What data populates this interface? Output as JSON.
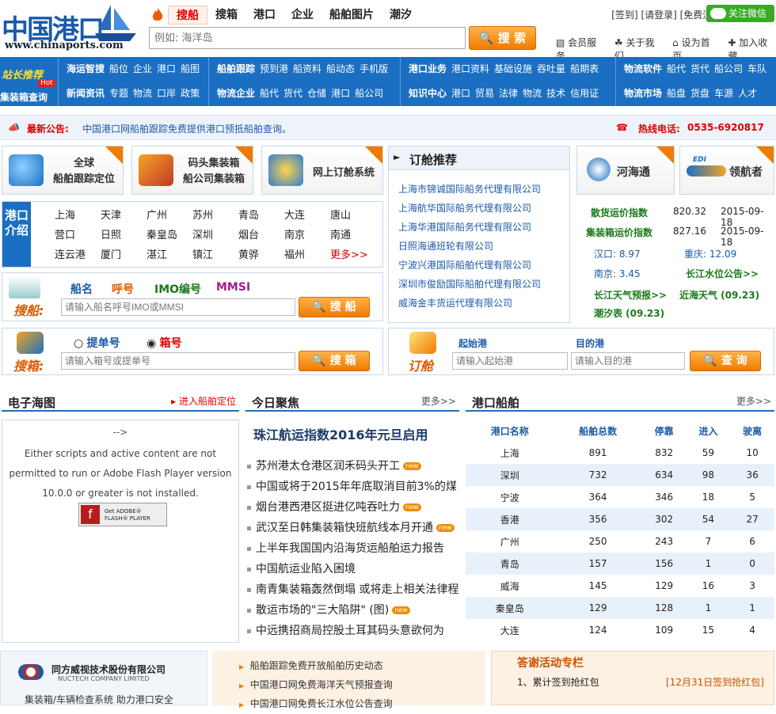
{
  "logo": {
    "cn": "中国港口",
    "en": "www.chinaports.com"
  },
  "topnav": {
    "tabs": [
      "搜船",
      "搜箱",
      "港口",
      "企业",
      "船舶图片",
      "潮汐"
    ]
  },
  "toplinks": {
    "text": "[签到] [请登录] [免费注册]",
    "wechat": "关注微信"
  },
  "search": {
    "placeholder": "例如: 海洋岛",
    "button": "搜 索"
  },
  "sublinks": [
    "会员服务",
    "关于我们",
    "设为首页",
    "加入收藏"
  ],
  "mainnav": {
    "g1": {
      "row1": [
        "站长推荐"
      ],
      "row2": [
        "集装箱查询"
      ],
      "hot": "Hot"
    },
    "g2": {
      "row1": [
        "海运智搜",
        "船位",
        "企业",
        "港口",
        "船图"
      ],
      "row2": [
        "新闻资讯",
        "专题",
        "物流",
        "口岸",
        "政策"
      ]
    },
    "g3": {
      "row1": [
        "船舶跟踪",
        "预到港",
        "船资料",
        "船动态",
        "手机版"
      ],
      "row2": [
        "物流企业",
        "船代",
        "货代",
        "仓储",
        "港口",
        "船公司"
      ]
    },
    "g4": {
      "row1": [
        "港口业务",
        "港口资料",
        "基础设施",
        "吞吐量",
        "船期表"
      ],
      "row2": [
        "知识中心",
        "港口",
        "贸易",
        "法律",
        "物流",
        "技术",
        "信用证"
      ]
    },
    "g5": {
      "row1": [
        "物流软件",
        "船代",
        "货代",
        "船公司",
        "车队"
      ],
      "row2": [
        "物流市场",
        "船盘",
        "货盘",
        "车源",
        "人才"
      ]
    }
  },
  "notice": {
    "label": "最新公告:",
    "text": "中国港口网船舶跟踪免费提供港口预抵船舶查询。",
    "hotline_label": "热线电话:",
    "hotline": "0535-6920817"
  },
  "tools": [
    {
      "line1": "全球",
      "line2": "船舶跟踪定位"
    },
    {
      "line1": "码头集装箱",
      "line2": "船公司集装箱"
    },
    {
      "line1": "网上订舱系统",
      "line2": ""
    }
  ],
  "ports": {
    "label": "港口介绍",
    "items": [
      "上海",
      "天津",
      "广州",
      "苏州",
      "青岛",
      "大连",
      "唐山",
      "营口",
      "日照",
      "秦皇岛",
      "深圳",
      "烟台",
      "南京",
      "南通",
      "连云港",
      "厦门",
      "湛江",
      "镇江",
      "黄骅",
      "福州",
      "更多>>"
    ]
  },
  "ship_search": {
    "label": "搜船:",
    "opts": [
      "船名",
      "呼号",
      "IMO编号",
      "MMSI"
    ],
    "placeholder": "请输入船名呼号IMO或MMSI",
    "button": "搜 船"
  },
  "box_search": {
    "label": "搜箱:",
    "radio1": "提单号",
    "radio2": "箱号",
    "placeholder": "请输入箱号或提单号",
    "button": "搜 箱"
  },
  "booking": {
    "title": "订舱推荐",
    "items": [
      "上海市锦诚国际船务代理有限公司",
      "上海航华国际船务代理有限公司",
      "上海华港国际船务代理有限公司",
      "日照海通班轮有限公司",
      "宁波兴港国际船舶代理有限公司",
      "深圳市俊励国际船舶代理有限公司",
      "威海金丰货运代理有限公司"
    ]
  },
  "order": {
    "label": "订舱",
    "from_label": "起始港",
    "to_label": "目的港",
    "from_ph": "请输入起始港",
    "to_ph": "请输入目的港",
    "button": "查 询"
  },
  "partners": {
    "a": "河海通",
    "b": "领航者",
    "b_tag": "EDI"
  },
  "index": {
    "r1": {
      "name": "散货运价指数",
      "val": "820.32",
      "date": "2015-09-18"
    },
    "r2": {
      "name": "集装箱运价指数",
      "val": "827.16",
      "date": "2015-09-18"
    },
    "w1": "汉口: 8.97",
    "w2": "重庆: 12.09",
    "w3": "南京: 3.45",
    "w4": "长江水位公告>>",
    "l1": "长江天气预报>>",
    "l2": "近海天气 (09.23)",
    "l3": "潮汐表 (09.23)"
  },
  "emap": {
    "title": "电子海图",
    "link": "进入船舶定位",
    "arrow": "-->",
    "msg": "Either scripts and active content are not permitted to run or Adobe Flash Player version 10.0.0 or greater is not installed.",
    "badge1": "Get ADOBE®",
    "badge2": "FLASH® PLAYER"
  },
  "today": {
    "title": "今日聚焦",
    "more": "更多>>",
    "headline": "珠江航运指数2016年元旦启用",
    "new_tag": "new",
    "items": [
      {
        "t": "苏州港太仓港区润禾码头开工",
        "new": true
      },
      {
        "t": "中国或将于2015年年底取消目前3%的煤",
        "new": false
      },
      {
        "t": "烟台港西港区挺进亿吨吞吐力",
        "new": true
      },
      {
        "t": "武汉至日韩集装箱快班航线本月开通",
        "new": true
      },
      {
        "t": "上半年我国国内沿海货运船舶运力报告",
        "new": false
      },
      {
        "t": "中国航运业陷入困境",
        "new": false
      },
      {
        "t": "南青集装箱轰然倒塌 或将走上相关法律程",
        "new": false
      },
      {
        "t": "散运市场的\"三大陷阱\" (图)",
        "new": true
      },
      {
        "t": "中远携招商局控股土耳其码头意欲何为",
        "new": false
      }
    ]
  },
  "portships": {
    "title": "港口船舶",
    "more": "更多>>",
    "headers": [
      "港口名称",
      "船舶总数",
      "停靠",
      "进入",
      "驶离"
    ],
    "rows": [
      [
        "上海",
        "891",
        "832",
        "59",
        "10"
      ],
      [
        "深圳",
        "732",
        "634",
        "98",
        "36"
      ],
      [
        "宁波",
        "364",
        "346",
        "18",
        "5"
      ],
      [
        "香港",
        "356",
        "302",
        "54",
        "27"
      ],
      [
        "广州",
        "250",
        "243",
        "7",
        "6"
      ],
      [
        "青岛",
        "157",
        "156",
        "1",
        "0"
      ],
      [
        "威海",
        "145",
        "129",
        "16",
        "3"
      ],
      [
        "秦皇岛",
        "129",
        "128",
        "1",
        "1"
      ],
      [
        "大连",
        "124",
        "109",
        "15",
        "4"
      ]
    ]
  },
  "nuctech": {
    "cn": "同方威视技术股份有限公司",
    "en": "NUCTECH COMPANY LIMITED",
    "slogan": "集装箱/车辆检查系统 助力港口安全"
  },
  "bottom_links": [
    "船舶跟踪免费开放船舶历史动态",
    "中国港口网免费海洋天气预报查询",
    "中国港口网免费长江水位公告查询"
  ],
  "thanks": {
    "title": "答谢活动专栏",
    "item": "1、累计签到抢红包",
    "link": "[12月31日签到抢红包]"
  }
}
